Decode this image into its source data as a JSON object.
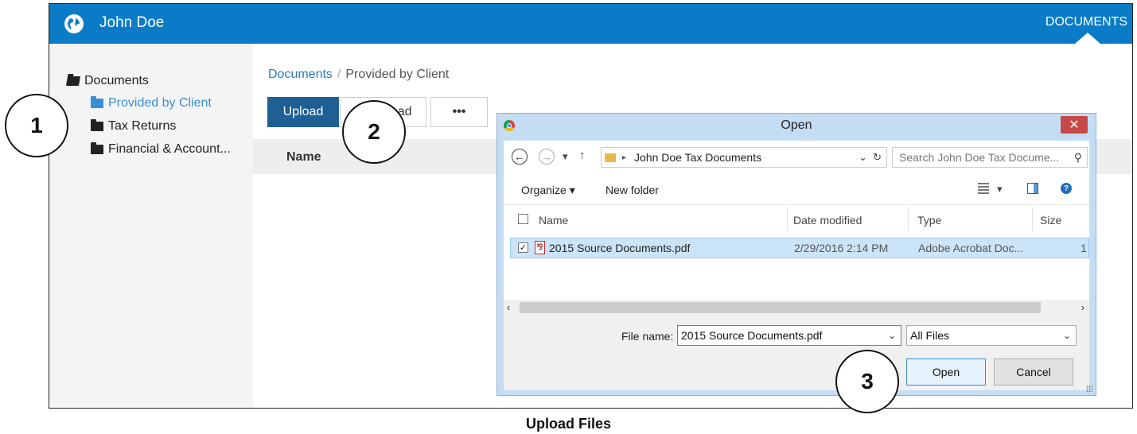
{
  "header": {
    "user_name": "John Doe",
    "section_link": "DOCUMENTS"
  },
  "sidebar": {
    "root": "Documents",
    "items": [
      {
        "label": "Provided by Client",
        "active": true
      },
      {
        "label": "Tax Returns",
        "active": false
      },
      {
        "label": "Financial & Account...",
        "active": false
      }
    ]
  },
  "breadcrumb": {
    "root": "Documents",
    "separator": "/",
    "current": "Provided by Client"
  },
  "toolbar": {
    "upload_label": "Upload",
    "download_label": "Download",
    "more_label": "•••"
  },
  "table": {
    "name_header": "Name"
  },
  "callouts": [
    "1",
    "2",
    "3"
  ],
  "dialog": {
    "title": "Open",
    "close_glyph": "✕",
    "path": "John Doe Tax  Documents",
    "search_placeholder": "Search John Doe Tax Docume...",
    "organize_label": "Organize ▾",
    "new_folder_label": "New folder",
    "columns": {
      "name": "Name",
      "date": "Date modified",
      "type": "Type",
      "size": "Size"
    },
    "files": [
      {
        "name": "2015 Source Documents.pdf",
        "date": "2/29/2016 2:14 PM",
        "type": "Adobe Acrobat Doc...",
        "size": "1",
        "selected": true
      }
    ],
    "file_name_label": "File name:",
    "file_name_value": "2015 Source Documents.pdf",
    "filter_value": "All Files",
    "open_button": "Open",
    "cancel_button": "Cancel"
  },
  "caption": "Upload Files",
  "colors": {
    "brand_blue": "#0a7cc7",
    "upload_button": "#1e5f94",
    "active_link": "#3a8fd6",
    "selection": "#cce4f7",
    "close_red": "#c74848"
  }
}
